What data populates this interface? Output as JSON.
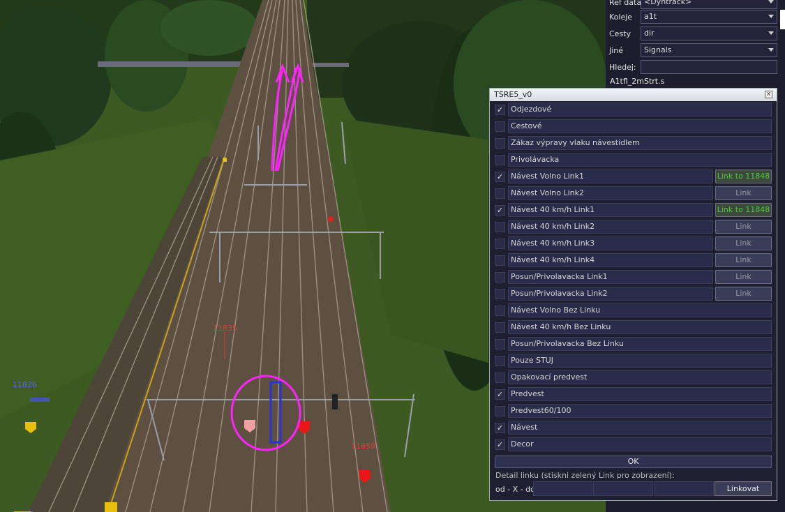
{
  "properties": {
    "rows": [
      {
        "label": "Ref data",
        "value": "<Dyntrack>"
      },
      {
        "label": "Koleje",
        "value": "a1t"
      },
      {
        "label": "Cesty",
        "value": "dir"
      },
      {
        "label": "Jiné",
        "value": "Signals"
      }
    ],
    "search_label": "Hledej:",
    "search_value": "",
    "file_name": "A1tfl_2mStrt.s"
  },
  "scene": {
    "labels": [
      "11826",
      "11835",
      "11859"
    ]
  },
  "dialog": {
    "title": "TSRE5_v0",
    "close_glyph": "x",
    "options": [
      {
        "label": "Odjezdové",
        "checked": "✓",
        "link": null
      },
      {
        "label": "Cestové",
        "checked": "",
        "link": null
      },
      {
        "label": "Zákaz výpravy vlaku návestidlem",
        "checked": "",
        "link": null
      },
      {
        "label": "Privolávacka",
        "checked": "",
        "link": null
      },
      {
        "label": "Návest Volno Link1",
        "checked": "✓",
        "link": "Link to 11848"
      },
      {
        "label": "Návest Volno Link2",
        "checked": "",
        "link": "Link"
      },
      {
        "label": "Návest 40 km/h Link1",
        "checked": "✓",
        "link": "Link to 11848"
      },
      {
        "label": "Návest 40 km/h Link2",
        "checked": "",
        "link": "Link"
      },
      {
        "label": "Návest 40 km/h Link3",
        "checked": "",
        "link": "Link"
      },
      {
        "label": "Návest 40 km/h Link4",
        "checked": "",
        "link": "Link"
      },
      {
        "label": "Posun/Privolavacka Link1",
        "checked": "",
        "link": "Link"
      },
      {
        "label": "Posun/Privolavacka Link2",
        "checked": "",
        "link": "Link"
      },
      {
        "label": "Návest Volno Bez Linku",
        "checked": "",
        "link": null
      },
      {
        "label": "Návest 40 km/h Bez Linku",
        "checked": "",
        "link": null
      },
      {
        "label": "Posun/Privolavacka Bez Linku",
        "checked": "",
        "link": null
      },
      {
        "label": "Pouze STUJ",
        "checked": "",
        "link": null
      },
      {
        "label": "Opakovací predvest",
        "checked": "",
        "link": null
      },
      {
        "label": "Predvest",
        "checked": "✓",
        "link": null
      },
      {
        "label": "Predvest60/100",
        "checked": "",
        "link": null
      },
      {
        "label": "Návest",
        "checked": "✓",
        "link": null
      },
      {
        "label": "Decor",
        "checked": "✓",
        "link": null
      }
    ],
    "ok_label": "OK",
    "detail_label": "Detail linku (stiskni zelený Link pro zobrazení):",
    "od_x_do_label": "od - X - do",
    "linkovat_label": "Linkovat"
  },
  "colors": {
    "accent_link_active": "#4cc84c",
    "annotation": "#ff22ff"
  }
}
